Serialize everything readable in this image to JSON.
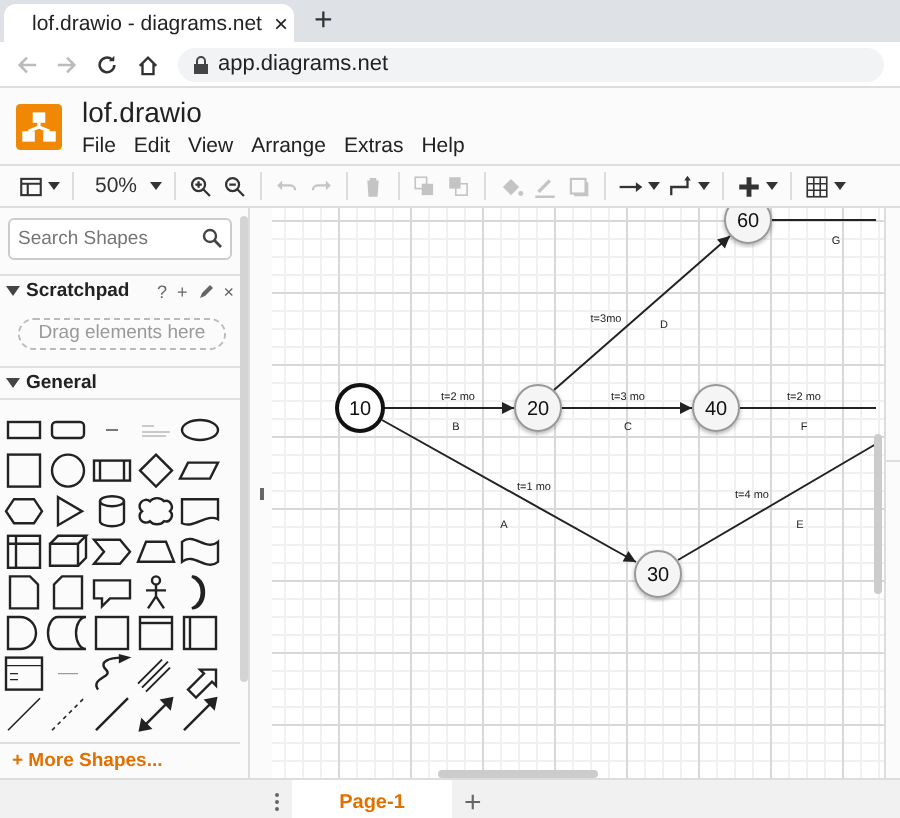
{
  "browser": {
    "tab_title": "lof.drawio - diagrams.net",
    "tab_close": "×",
    "new_tab": "+",
    "url": "app.diagrams.net"
  },
  "app": {
    "title": "lof.drawio",
    "menu": [
      "File",
      "Edit",
      "View",
      "Arrange",
      "Extras",
      "Help"
    ]
  },
  "toolbar": [
    {
      "kind": "panel",
      "disabled": false
    },
    {
      "kind": "zoom",
      "label": "50%",
      "disabled": false
    },
    {
      "kind": "zoom_in",
      "disabled": false
    },
    {
      "kind": "zoom_out",
      "disabled": false
    },
    {
      "kind": "undo",
      "disabled": true
    },
    {
      "kind": "redo",
      "disabled": true
    },
    {
      "kind": "delete",
      "disabled": true
    },
    {
      "kind": "to_front",
      "disabled": true
    },
    {
      "kind": "to_back",
      "disabled": true
    },
    {
      "kind": "fill",
      "disabled": true
    },
    {
      "kind": "line",
      "disabled": true
    },
    {
      "kind": "shadow",
      "disabled": true
    },
    {
      "kind": "connection",
      "disabled": false
    },
    {
      "kind": "waypoints",
      "disabled": false
    },
    {
      "kind": "insert",
      "disabled": false
    },
    {
      "kind": "table",
      "disabled": false
    }
  ],
  "sidebar": {
    "search": {
      "placeholder": "Search Shapes"
    },
    "scratchpad": {
      "title": "Scratchpad",
      "expanded": true,
      "help": "?",
      "add": "+",
      "close": "×",
      "drop_hint": "Drag elements here"
    },
    "general": {
      "title": "General",
      "expanded": true
    },
    "more_shapes": "+ More Shapes..."
  },
  "diagram": {
    "nodes": [
      {
        "label": "10",
        "emphasized": true
      },
      {
        "label": "20",
        "emphasized": false
      },
      {
        "label": "40",
        "emphasized": false
      },
      {
        "label": "60",
        "emphasized": false
      },
      {
        "label": "30",
        "emphasized": false
      }
    ],
    "edges": [
      {
        "duration": "t=2 mo",
        "activity": "B"
      },
      {
        "duration": "t=3 mo",
        "activity": "C"
      },
      {
        "duration": "t=2 mo",
        "activity": "F"
      },
      {
        "duration": "t=3mo",
        "activity": "D"
      },
      {
        "activity": "G"
      },
      {
        "duration": "t=1 mo",
        "activity": "A"
      },
      {
        "duration": "t=4 mo",
        "activity": "E"
      }
    ]
  },
  "pages": [
    {
      "label": "Page-1",
      "selected": true
    }
  ],
  "add_page": "+"
}
